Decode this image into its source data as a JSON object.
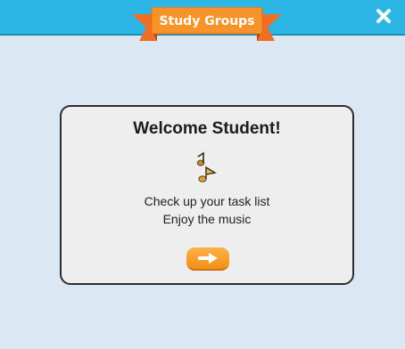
{
  "header": {
    "title": "Study Groups",
    "close_icon": "close-icon",
    "bar_color": "#2bb6e6",
    "ribbon_color": "#f8932a"
  },
  "dialog": {
    "title": "Welcome Student!",
    "icon": "music-note-icon",
    "line1": "Check up your task list",
    "line2": "Enjoy the music",
    "next_icon": "arrow-right-icon",
    "button_color": "#f79a2a"
  }
}
